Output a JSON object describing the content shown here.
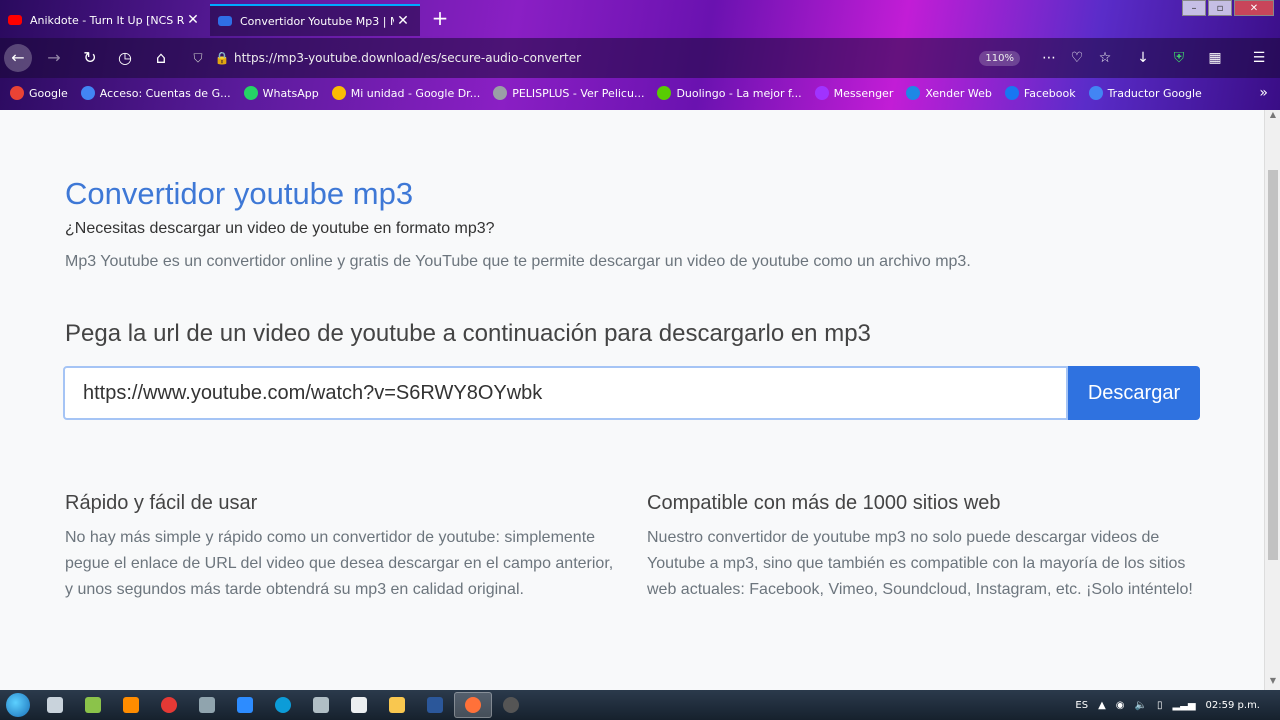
{
  "browser": {
    "tabs": [
      {
        "title": "Anikdote - Turn It Up [NCS R",
        "favicon": "youtube-icon"
      },
      {
        "title": "Convertidor Youtube Mp3 | M",
        "favicon": "site-icon"
      }
    ],
    "url": "https://mp3-youtube.download/es/secure-audio-converter",
    "zoom": "110%",
    "bookmarks": [
      {
        "label": "Google",
        "color": "#ea4335"
      },
      {
        "label": "Acceso: Cuentas de G...",
        "color": "#4285f4"
      },
      {
        "label": "WhatsApp",
        "color": "#25d366"
      },
      {
        "label": "Mi unidad - Google Dr...",
        "color": "#fbbc04"
      },
      {
        "label": "PELISPLUS - Ver Pelicu...",
        "color": "#9aa0a6"
      },
      {
        "label": "Duolingo - La mejor f...",
        "color": "#58cc02"
      },
      {
        "label": "Messenger",
        "color": "#a033ff"
      },
      {
        "label": "Xender Web",
        "color": "#1e88e5"
      },
      {
        "label": "Facebook",
        "color": "#1877f2"
      },
      {
        "label": "Traductor Google",
        "color": "#4285f4"
      }
    ]
  },
  "page": {
    "title": "Convertidor youtube mp3",
    "question": "¿Necesitas descargar un video de youtube en formato mp3?",
    "description": "Mp3 Youtube es un convertidor online y gratis de YouTube que te permite descargar un video de youtube como un archivo mp3.",
    "paste_heading": "Pega la url de un video de youtube a continuación para descargarlo en mp3",
    "url_input_value": "https://www.youtube.com/watch?v=S6RWY8OYwbk",
    "download_button": "Descargar",
    "features": [
      {
        "title": "Rápido y fácil de usar",
        "text": "No hay más simple y rápido como un convertidor de youtube: simplemente pegue el enlace de URL del video que desea descargar en el campo anterior, y unos segundos más tarde obtendrá su mp3 en calidad original."
      },
      {
        "title": "Compatible con más de 1000 sitios web",
        "text": "Nuestro convertidor de youtube mp3 no solo puede descargar videos de Youtube a mp3, sino que también es compatible con la mayoría de los sitios web actuales: Facebook, Vimeo, Soundcloud, Instagram, etc. ¡Solo inténtelo!"
      }
    ],
    "accent_color": "#3e78d6",
    "button_color": "#2f72e0"
  },
  "taskbar": {
    "language": "ES",
    "time": "02:59 p.m."
  }
}
